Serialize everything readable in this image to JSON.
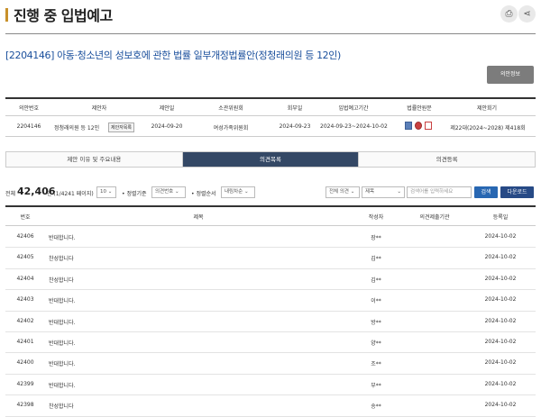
{
  "page": {
    "title": "진행 중 입법예고"
  },
  "bill": {
    "title": "[2204146] 아동·청소년의 성보호에 관한 법률 일부개정법률안(정청래의원 등 12인)",
    "info_button": "의안정보"
  },
  "info_table": {
    "headers": [
      "의안번호",
      "제안자",
      "제안일",
      "소관위원회",
      "회부일",
      "입법예고기간",
      "법률안원문",
      "제안회기"
    ],
    "row": {
      "bill_no": "2204146",
      "proposer": "정청래의원 등 12인",
      "proposer_tag": "제안자목록",
      "proposed_date": "2024-09-20",
      "committee": "여성가족위원회",
      "referral_date": "2024-09-23",
      "period": "2024-09-23~2024-10-02",
      "session": "제22대(2024~2028) 제418회"
    }
  },
  "tabs": [
    {
      "label": "제안 이유 및 주요내용",
      "active": false
    },
    {
      "label": "의견목록",
      "active": true
    },
    {
      "label": "의견등록",
      "active": false
    }
  ],
  "toolbar": {
    "total_prefix": "전체",
    "total_count": "42,406",
    "total_suffix": "건 (1/4241 페이지)",
    "page_size": "10",
    "sort_label": "정렬기준",
    "sort_value": "의견번호",
    "order_label": "정렬순서",
    "order_value": "내림차순",
    "filter_opinion": "전체 의견",
    "filter_field": "제목",
    "search_placeholder": "검색어를 입력하세요",
    "search_button": "검색",
    "download_button": "다운로드"
  },
  "list": {
    "headers": [
      "번호",
      "제목",
      "작성자",
      "의견제출기관",
      "등록일"
    ],
    "rows": [
      {
        "no": "42406",
        "title": "반대합니다.",
        "author": "장**",
        "org": "",
        "date": "2024-10-02"
      },
      {
        "no": "42405",
        "title": "찬성합니다",
        "author": "김**",
        "org": "",
        "date": "2024-10-02"
      },
      {
        "no": "42404",
        "title": "찬성합니다",
        "author": "김**",
        "org": "",
        "date": "2024-10-02"
      },
      {
        "no": "42403",
        "title": "반대합니다.",
        "author": "이**",
        "org": "",
        "date": "2024-10-02"
      },
      {
        "no": "42402",
        "title": "반대합니다.",
        "author": "방**",
        "org": "",
        "date": "2024-10-02"
      },
      {
        "no": "42401",
        "title": "반대합니다.",
        "author": "양**",
        "org": "",
        "date": "2024-10-02"
      },
      {
        "no": "42400",
        "title": "반대합니다.",
        "author": "조**",
        "org": "",
        "date": "2024-10-02"
      },
      {
        "no": "42399",
        "title": "반대합니다.",
        "author": "부**",
        "org": "",
        "date": "2024-10-02"
      },
      {
        "no": "42398",
        "title": "찬성합니다",
        "author": "송**",
        "org": "",
        "date": "2024-10-02"
      }
    ]
  },
  "icons": [
    "print-icon",
    "share-icon",
    "hwp-file-icon",
    "pdf-file-icon",
    "doc-file-icon",
    "chevron-down-icon"
  ],
  "colors": {
    "accent": "#c8912b",
    "link": "#1a4f9c",
    "active_tab": "#344865",
    "search": "#2867b2",
    "download": "#274a86"
  }
}
